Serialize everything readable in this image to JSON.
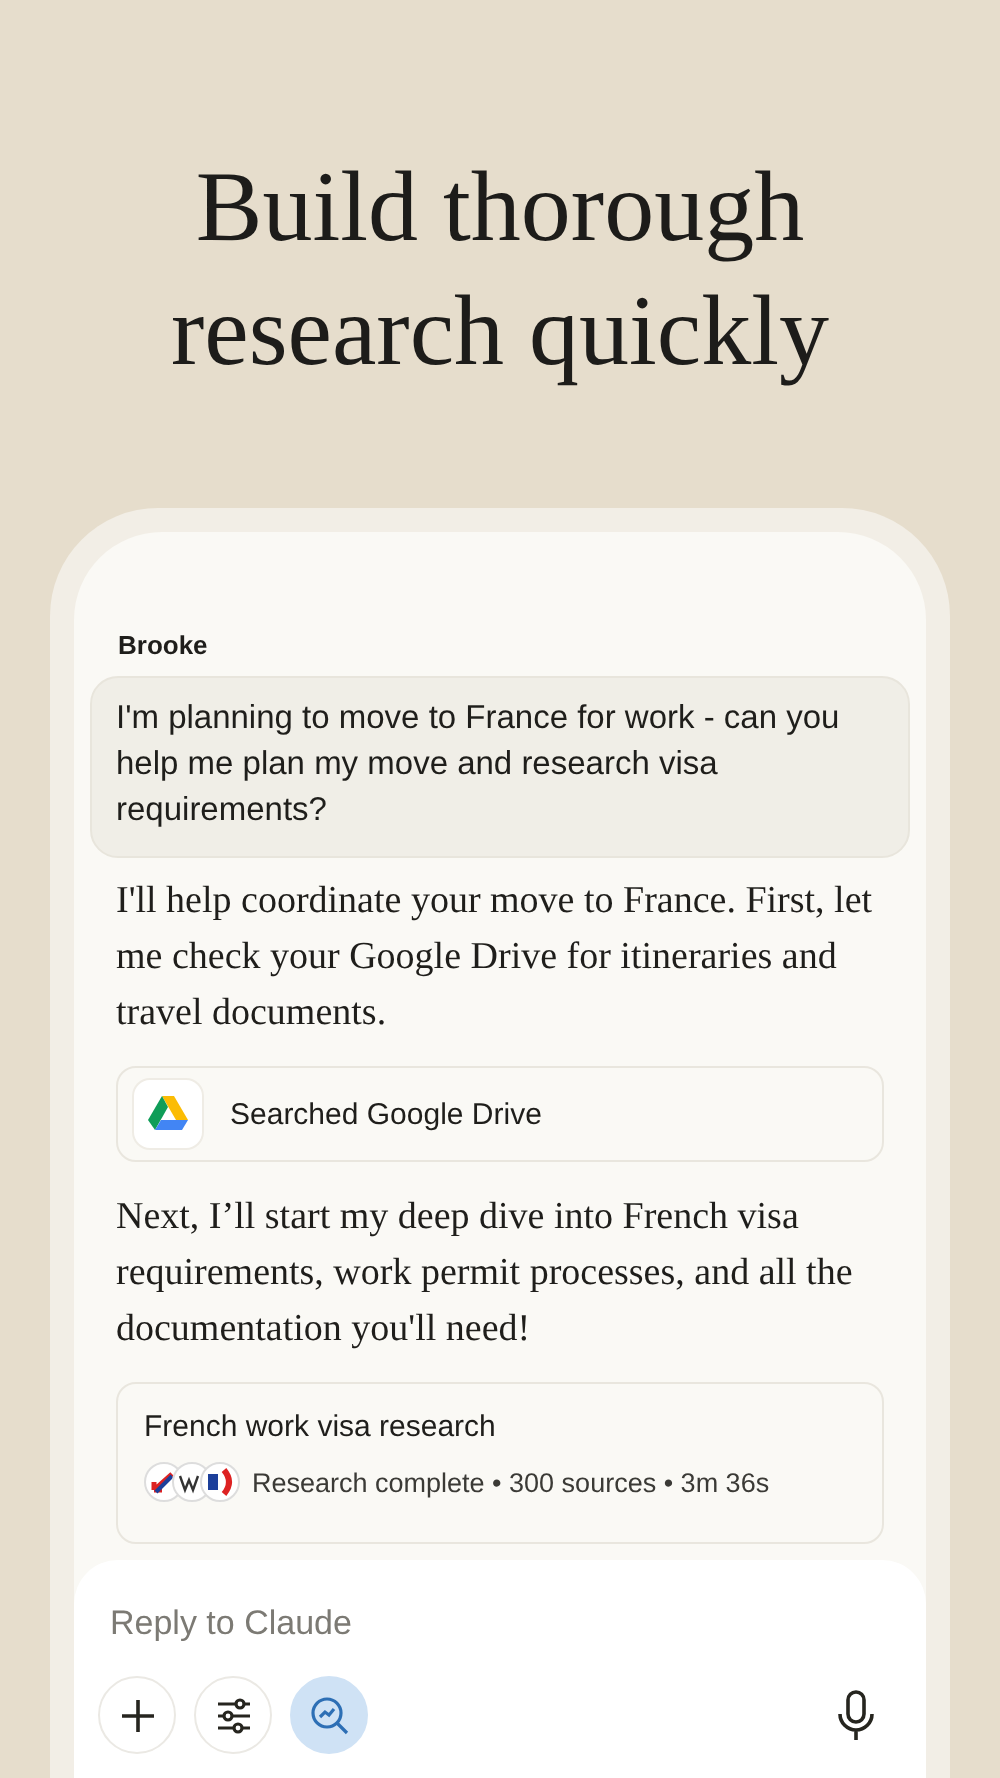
{
  "headline": "Build thorough research quickly",
  "chat": {
    "user_name": "Brooke",
    "user_message": "I'm planning to move to France for work - can you help me plan my move and research visa requirements?",
    "messages": [
      {
        "kind": "text",
        "text": "I'll help coordinate your move to France. First, let me check your Google Drive for itineraries and travel documents."
      },
      {
        "kind": "tool",
        "label": "Searched Google Drive"
      },
      {
        "kind": "text",
        "text": "Next, I’ll start my deep dive into French visa requirements, work permit processes, and all the documentation you'll need!"
      },
      {
        "kind": "research",
        "title": "French work visa research",
        "status": "Research complete • 300 sources • 3m 36s"
      }
    ]
  },
  "composer": {
    "placeholder": "Reply to Claude",
    "tools": [
      {
        "kind": "add",
        "selected": false
      },
      {
        "kind": "settings",
        "selected": false
      },
      {
        "kind": "research",
        "selected": true
      }
    ]
  }
}
